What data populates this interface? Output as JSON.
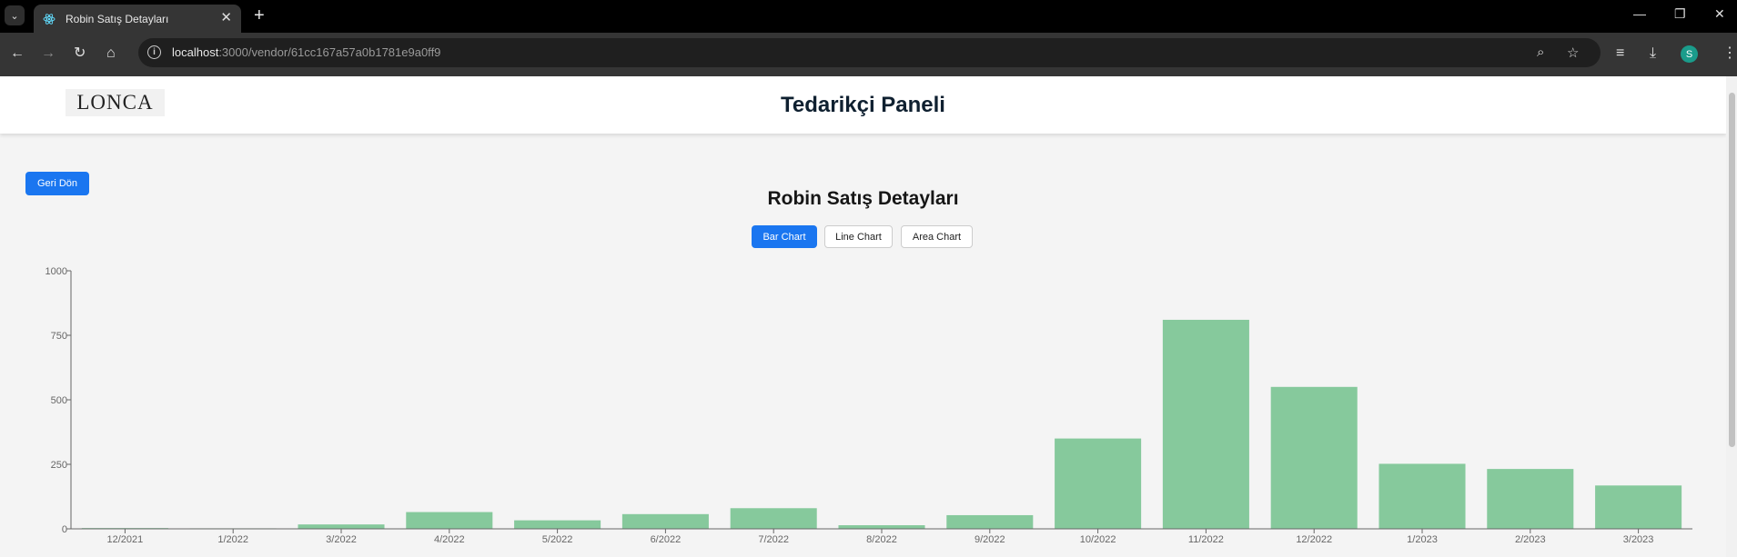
{
  "browser": {
    "tab_title": "Robin Satış Detayları",
    "url_host": "localhost",
    "url_path": ":3000/vendor/61cc167a57a0b1781e9a0ff9",
    "profile_initial": "S"
  },
  "header": {
    "logo_text": "LONCA",
    "title": "Tedarikçi Paneli"
  },
  "page": {
    "back_label": "Geri Dön",
    "title": "Robin Satış Detayları",
    "chart_buttons": [
      "Bar Chart",
      "Line Chart",
      "Area Chart"
    ],
    "active_chart": "Bar Chart"
  },
  "colors": {
    "bar": "#86c99c",
    "primary": "#1a76f0"
  },
  "chart_data": {
    "type": "bar",
    "categories": [
      "12/2021",
      "1/2022",
      "3/2022",
      "4/2022",
      "5/2022",
      "6/2022",
      "7/2022",
      "8/2022",
      "9/2022",
      "10/2022",
      "11/2022",
      "12/2022",
      "1/2023",
      "2/2023",
      "3/2023"
    ],
    "values": [
      3,
      2,
      17,
      65,
      33,
      57,
      80,
      14,
      53,
      350,
      810,
      550,
      252,
      232,
      168
    ],
    "y_ticks": [
      0,
      250,
      500,
      750,
      1000
    ],
    "ylim": [
      0,
      1000
    ],
    "grid": false,
    "title": "",
    "xlabel": "",
    "ylabel": ""
  }
}
